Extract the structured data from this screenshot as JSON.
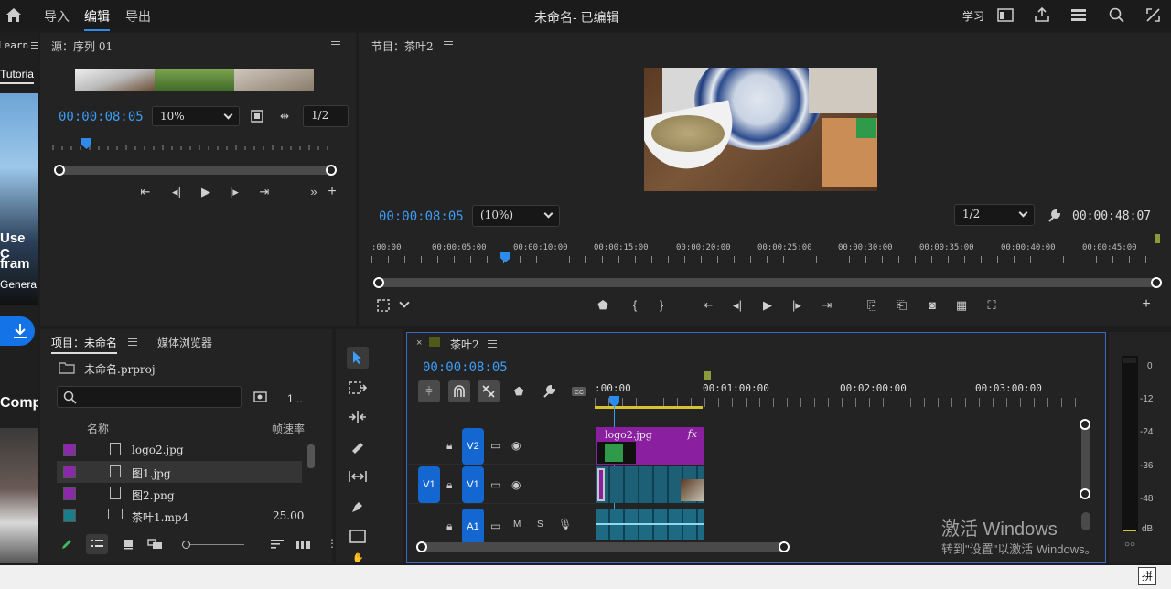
{
  "topbar": {
    "nav": [
      "导入",
      "编辑",
      "导出"
    ],
    "title": "未命名- 已编辑",
    "learn": "学习"
  },
  "left_strip": {
    "learn_tab": "Learn",
    "tutorial_tab": "Tutoria",
    "promo_line1": "Use C",
    "promo_line2": "fram",
    "promo_line3": "Genera",
    "comp": "Comp"
  },
  "source": {
    "title": "源：序列 01",
    "timecode": "00:00:08:05",
    "zoom": "10%",
    "resolution": "1/2"
  },
  "program": {
    "title": "节目：茶叶2",
    "timecode": "00:00:08:05",
    "zoom": "(10%)",
    "resolution": "1/2",
    "duration": "00:00:48:07",
    "ruler": [
      ":00:00",
      "00:00:05:00",
      "00:00:10:00",
      "00:00:15:00",
      "00:00:20:00",
      "00:00:25:00",
      "00:00:30:00",
      "00:00:35:00",
      "00:00:40:00",
      "00:00:45:00"
    ]
  },
  "project": {
    "tab_project": "项目：未命名",
    "tab_media": "媒体浏览器",
    "file": "未命名.prproj",
    "count": "1...",
    "col_name": "名称",
    "col_fps": "帧速率",
    "items": [
      {
        "name": "logo2.jpg",
        "fps": "",
        "color": "#8a2aa8"
      },
      {
        "name": "图1.jpg",
        "fps": "",
        "color": "#8a2aa8"
      },
      {
        "name": "图2.png",
        "fps": "",
        "color": "#8a2aa8"
      },
      {
        "name": "茶叶1.mp4",
        "fps": "25.00",
        "color": "#1b7d8a"
      }
    ]
  },
  "timeline": {
    "tab": "茶叶2",
    "timecode": "00:00:08:05",
    "ruler": [
      ":00:00",
      "00:01:00:00",
      "00:02:00:00",
      "00:03:00:00"
    ],
    "tracks": {
      "v2": "V2",
      "v1": "V1",
      "v1_source": "V1",
      "a1": "A1",
      "m": "M",
      "s": "S"
    },
    "clip_logo": "logo2.jpg",
    "clip_fx": "fx"
  },
  "meter": {
    "labels": [
      "0",
      "-12",
      "-24",
      "-36",
      "-48",
      "dB"
    ]
  },
  "watermark": {
    "line1": "激活 Windows",
    "line2": "转到\"设置\"以激活 Windows。"
  },
  "taskbar": {
    "ime": "拼"
  }
}
